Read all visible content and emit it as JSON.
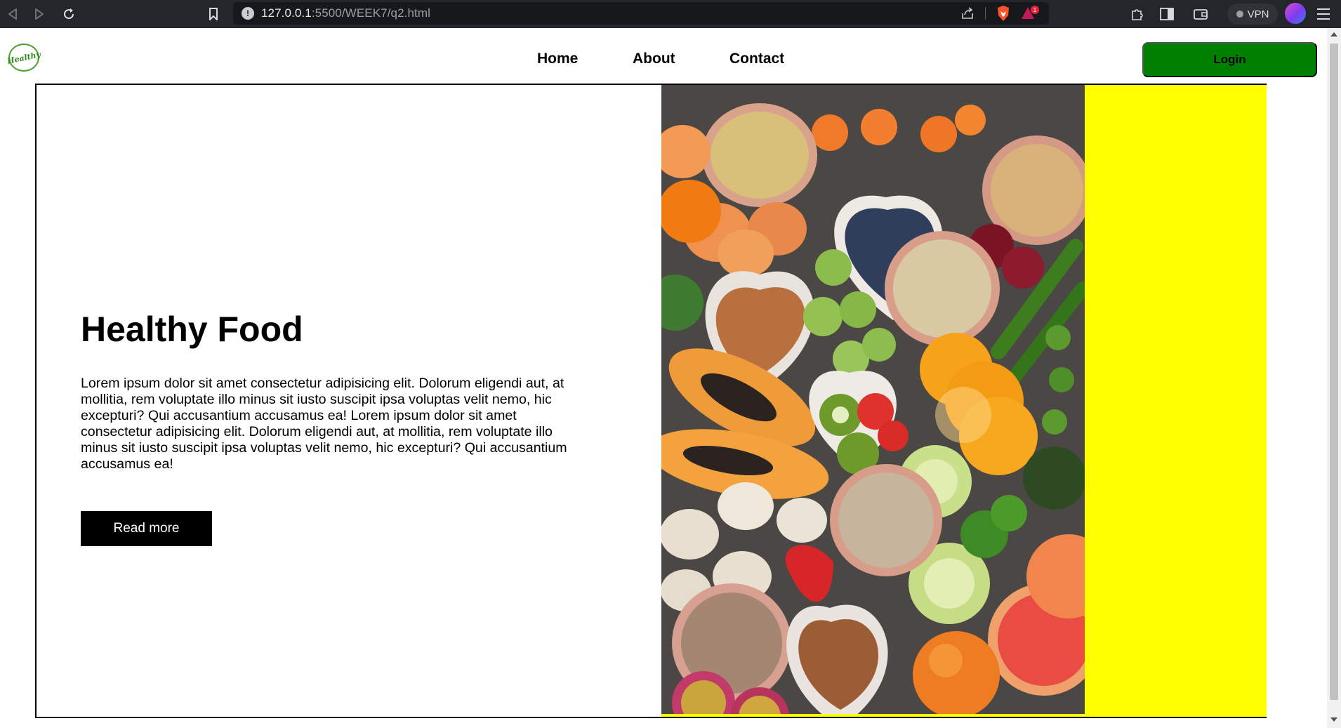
{
  "browser": {
    "url_host": "127.0.0.1",
    "url_rest": ":5500/WEEK7/q2.html",
    "vpn_label": "VPN",
    "rewards_badge": "1"
  },
  "site": {
    "logo_text": "Healthy",
    "nav": [
      {
        "label": "Home"
      },
      {
        "label": "About"
      },
      {
        "label": "Contact"
      }
    ],
    "login_label": "Login",
    "login_color": "#008000"
  },
  "hero": {
    "title": "Healthy Food",
    "body": "Lorem ipsum dolor sit amet consectetur adipisicing elit. Dolorum eligendi aut, at mollitia, rem voluptate illo minus sit iusto suscipit ipsa voluptas velit nemo, hic excepturi? Qui accusantium accusamus ea! Lorem ipsum dolor sit amet consectetur adipisicing elit. Dolorum eligendi aut, at mollitia, rem voluptate illo minus sit iusto suscipit ipsa voluptas velit nemo, hic excepturi? Qui accusantium accusamus ea!",
    "button_label": "Read more",
    "accent_panel_color": "#ffff00"
  }
}
